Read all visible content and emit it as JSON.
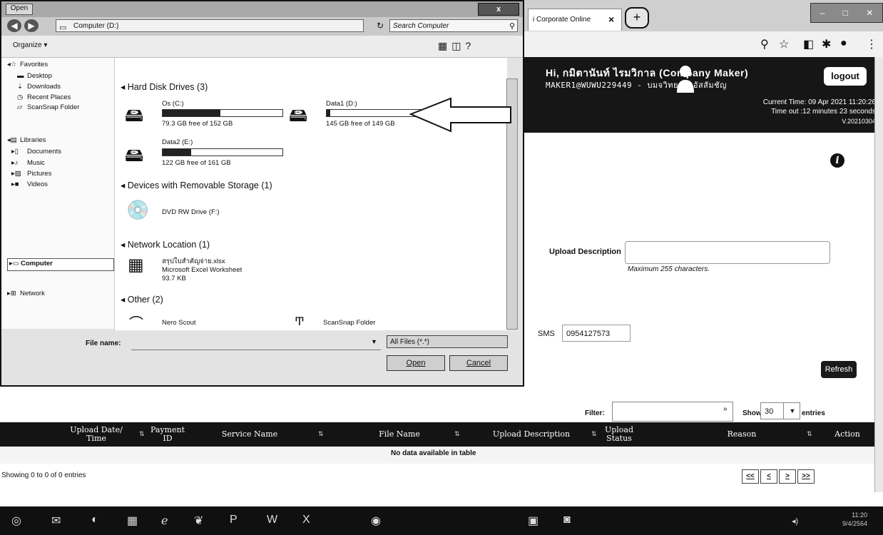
{
  "browser": {
    "tab_title": "i Corporate Online",
    "tab_close": "×",
    "new_tab": "+",
    "window_controls": [
      "–",
      "□",
      "✕"
    ],
    "toolbar_icons": [
      "zoom-icon",
      "star-icon",
      "extension-icon",
      "puzzle-icon",
      "profile-icon",
      "menu-icon"
    ],
    "toolbar_glyphs": [
      "⚲",
      "☆",
      "◧",
      "✱",
      "●",
      "⋮"
    ]
  },
  "header": {
    "greeting": "Hi, กมิตานันท์ ไรมวิกาล (Company Maker)",
    "maker_id": "MAKER1@WUWU229449 - บมจวิทยาลัยอัสสัมชัญ",
    "current_time": "Current Time: 09 Apr 2021 11:20:26",
    "time_out": "Time out :12 minutes 23 seconds",
    "version": "V.20210304",
    "logout": "logout",
    "info": "i"
  },
  "form": {
    "upload_description_label": "Upload Description",
    "upload_description_value": "",
    "upload_description_hint": "Maximum 255 characters.",
    "sms_label": "SMS",
    "sms_value": "0954127573",
    "refresh": "Refresh",
    "filter_label": "Filter:",
    "filter_value": "",
    "show_label": "Show",
    "show_value": "30",
    "entries_label": "entries"
  },
  "table": {
    "columns": [
      {
        "label": "Upload Date/ Time"
      },
      {
        "label": "Payment ID"
      },
      {
        "label": "Service Name"
      },
      {
        "label": "File Name"
      },
      {
        "label": "Upload Description"
      },
      {
        "label": "Upload Status"
      },
      {
        "label": "Reason"
      },
      {
        "label": "Action"
      }
    ],
    "empty_message": "No data available in table",
    "showing": "Showing 0 to 0 of 0 entries",
    "pager": [
      "<<",
      "<",
      ">",
      ">>"
    ]
  },
  "dialog": {
    "title": "Open",
    "close": "x",
    "breadcrumb": "Computer (D:)",
    "search_placeholder": "Search Computer",
    "organize": "Organize ▾",
    "nav": {
      "favorites": "Favorites",
      "desktop": "Desktop",
      "downloads": "Downloads",
      "recent_places": "Recent Places",
      "scansnap_folder": "ScanSnap Folder",
      "libraries": "Libraries",
      "documents": "Documents",
      "music": "Music",
      "pictures": "Pictures",
      "videos": "Videos",
      "computer": "Computer",
      "network": "Network"
    },
    "groups": {
      "hard_disk_drives": "Hard Disk Drives (3)",
      "removable": "Devices with Removable Storage (1)",
      "network_location": "Network Location (1)",
      "other": "Other (2)"
    },
    "drives": [
      {
        "name": "Os (C:)",
        "free": "79.3 GB free of 152 GB",
        "used_fraction": 0.48
      },
      {
        "name": "Data1 (D:)",
        "free": "145 GB free of 149 GB",
        "used_fraction": 0.03
      },
      {
        "name": "Data2 (E:)",
        "free": "122 GB free of 161 GB",
        "used_fraction": 0.24
      }
    ],
    "dvd": "DVD RW Drive (F:)",
    "net_file": {
      "name": "สรุปใบสำคัญจ่าย.xlsx",
      "type": "Microsoft Excel Worksheet",
      "size": "93.7 KB"
    },
    "other_items": [
      "Nero Scout",
      "ScanSnap Folder"
    ],
    "file_name_label": "File name:",
    "file_name_value": "",
    "file_type": "All Files (*.*)",
    "open": "Open",
    "cancel": "Cancel"
  },
  "taskbar": {
    "time": "11:20",
    "date": "9/4/2564"
  }
}
